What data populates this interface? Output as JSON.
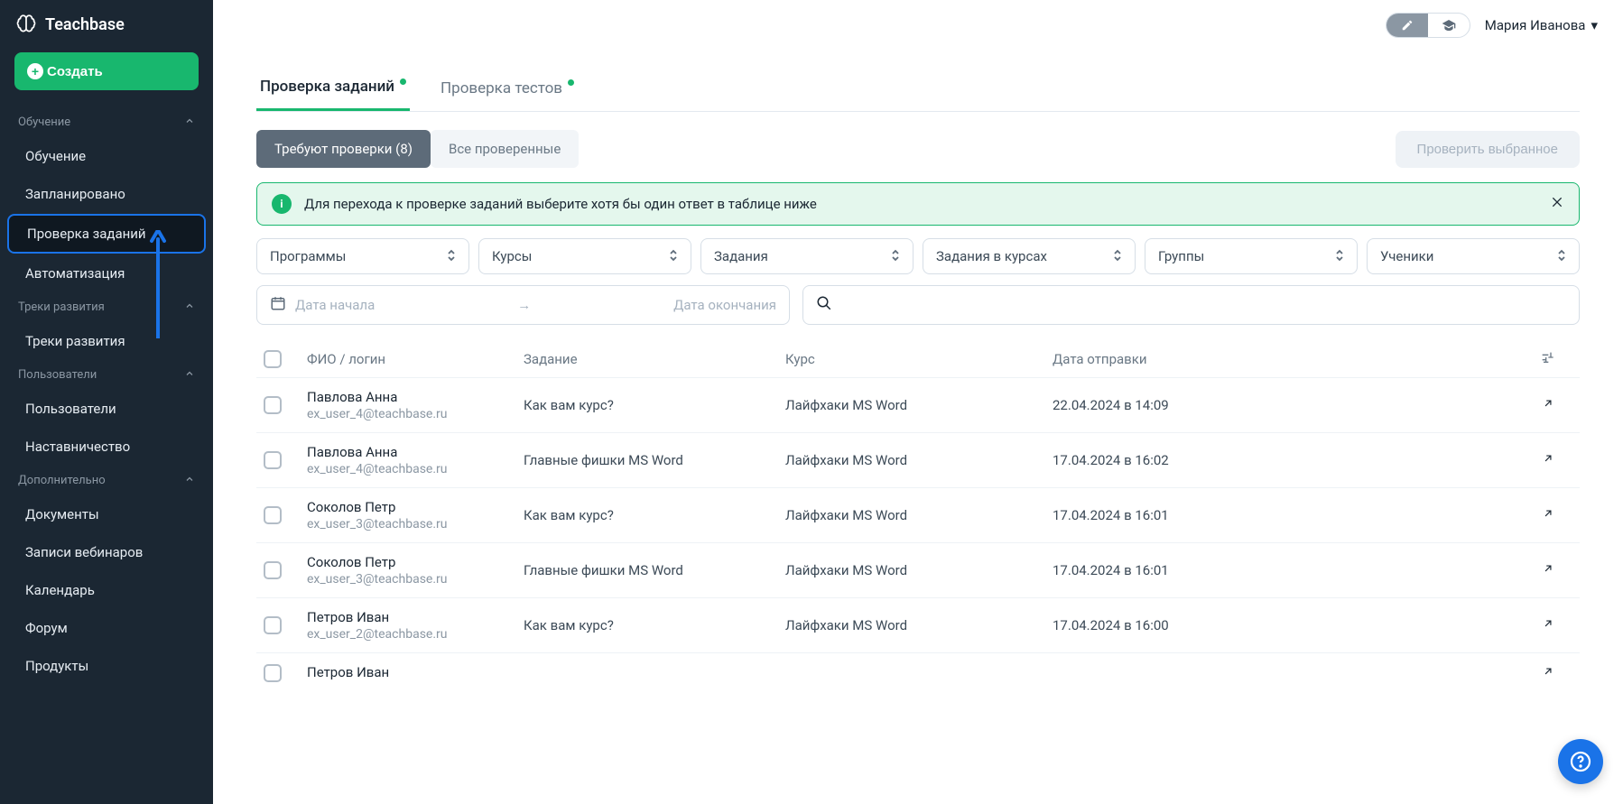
{
  "brand": "Teachbase",
  "create_label": "Создать",
  "user_name": "Мария Иванова",
  "sidebar": {
    "sections": [
      {
        "header": "Обучение",
        "items": [
          "Обучение",
          "Запланировано",
          "Проверка заданий",
          "Автоматизация"
        ],
        "active_index": 2
      },
      {
        "header": "Треки развития",
        "items": [
          "Треки развития"
        ]
      },
      {
        "header": "Пользователи",
        "items": [
          "Пользователи",
          "Наставничество"
        ]
      },
      {
        "header": "Дополнительно",
        "items": [
          "Документы",
          "Записи вебинаров",
          "Календарь",
          "Форум",
          "Продукты"
        ]
      }
    ]
  },
  "tabs": [
    {
      "label": "Проверка заданий",
      "active": true,
      "dot": true
    },
    {
      "label": "Проверка тестов",
      "active": false,
      "dot": true
    }
  ],
  "pills": [
    {
      "label": "Требуют проверки (8)",
      "active": true
    },
    {
      "label": "Все проверенные",
      "active": false
    }
  ],
  "check_selected_label": "Проверить выбранное",
  "info_text": "Для перехода к проверке заданий выберите хотя бы один ответ в таблице ниже",
  "filters": [
    "Программы",
    "Курсы",
    "Задания",
    "Задания в курсах",
    "Группы",
    "Ученики"
  ],
  "date_placeholders": {
    "start": "Дата начала",
    "end": "Дата окончания"
  },
  "table": {
    "headers": {
      "name": "ФИО / логин",
      "task": "Задание",
      "course": "Курс",
      "date": "Дата отправки"
    },
    "rows": [
      {
        "name": "Павлова Анна",
        "email": "ex_user_4@teachbase.ru",
        "task": "Как вам курс?",
        "course": "Лайфхаки MS Word",
        "date": "22.04.2024 в 14:09"
      },
      {
        "name": "Павлова Анна",
        "email": "ex_user_4@teachbase.ru",
        "task": "Главные фишки MS Word",
        "course": "Лайфхаки MS Word",
        "date": "17.04.2024 в 16:02"
      },
      {
        "name": "Соколов Петр",
        "email": "ex_user_3@teachbase.ru",
        "task": "Как вам курс?",
        "course": "Лайфхаки MS Word",
        "date": "17.04.2024 в 16:01"
      },
      {
        "name": "Соколов Петр",
        "email": "ex_user_3@teachbase.ru",
        "task": "Главные фишки MS Word",
        "course": "Лайфхаки MS Word",
        "date": "17.04.2024 в 16:01"
      },
      {
        "name": "Петров Иван",
        "email": "ex_user_2@teachbase.ru",
        "task": "Как вам курс?",
        "course": "Лайфхаки MS Word",
        "date": "17.04.2024 в 16:00"
      },
      {
        "name": "Петров Иван",
        "email": "",
        "task": "",
        "course": "",
        "date": ""
      }
    ]
  }
}
